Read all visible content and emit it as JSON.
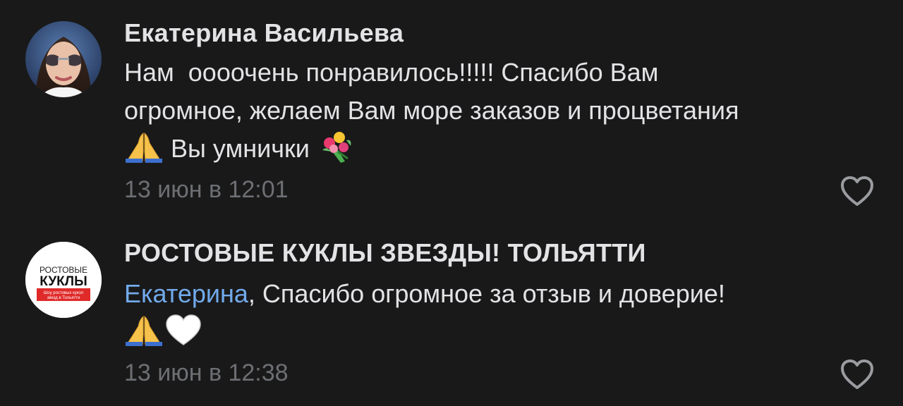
{
  "comments": [
    {
      "author": "Екатерина Васильева",
      "avatar_icon": "user-photo-woman-sunglasses",
      "text_lines": [
        "Нам  оооочень понравилось!!!!! Спасибо Вам",
        "огромное, желаем Вам море заказов и процветания",
        " Вы умнички "
      ],
      "emojis": [
        "folded-hands",
        "bouquet"
      ],
      "time": "13 июн в 12:01",
      "like_icon": "heart-outline-icon"
    },
    {
      "author": "РОСТОВЫЕ КУКЛЫ ЗВЕЗДЫ! ТОЛЬЯТТИ",
      "avatar": {
        "line1": "РОСТОВЫЕ",
        "line2": "КУКЛЫ",
        "line3": "Шоу ростовых кукол",
        "line4": "звезд в Тольятти"
      },
      "mention": "Екатерина",
      "text": ", Спасибо огромное за отзыв и доверие!",
      "emojis": [
        "folded-hands",
        "white-heart"
      ],
      "time": "13 июн в 12:38",
      "like_icon": "heart-outline-icon"
    }
  ],
  "colors": {
    "background": "#19191a",
    "text": "#e3e3e6",
    "muted": "#6d6f73",
    "mention": "#71aaeb",
    "avatar_red": "#e02a2a"
  }
}
